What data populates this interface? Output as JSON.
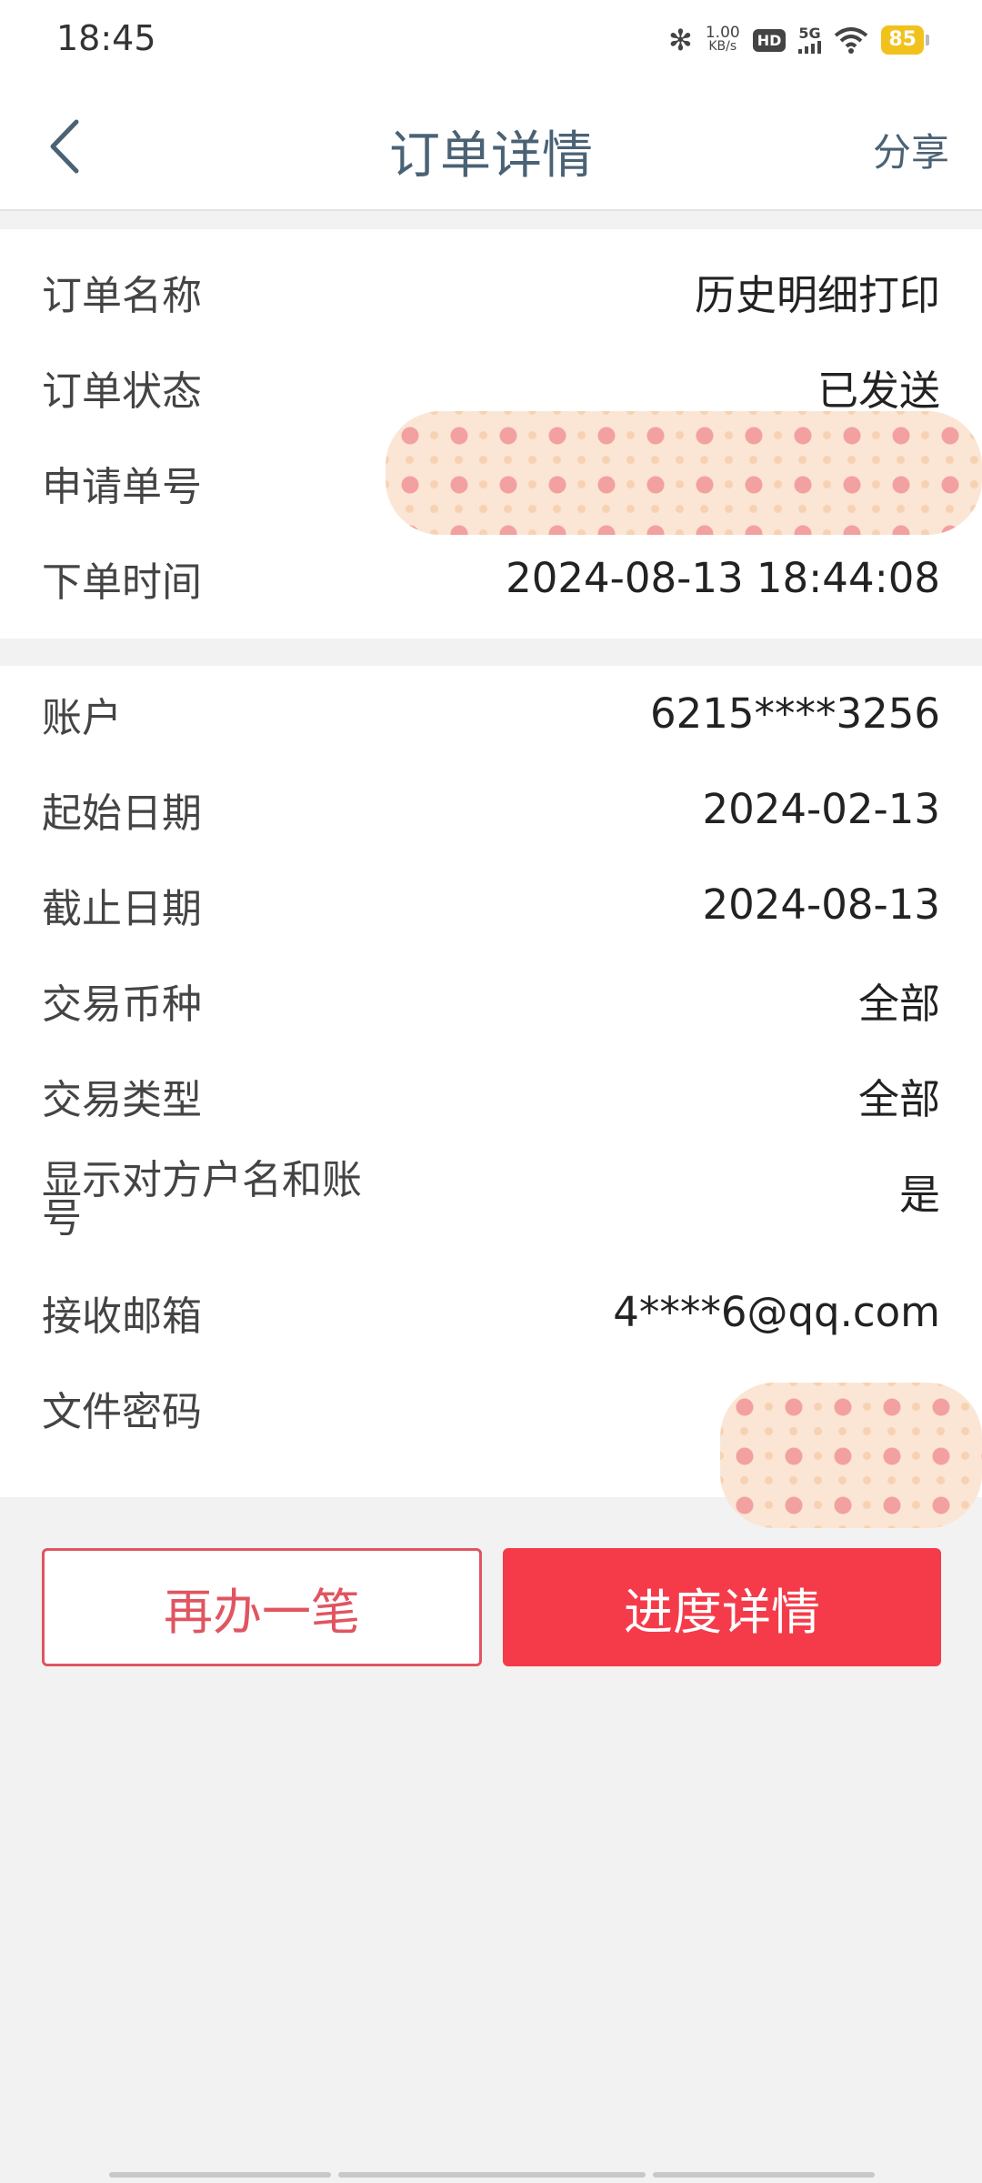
{
  "status_bar": {
    "time": "18:45",
    "speed_value": "1.00",
    "speed_unit": "KB/s",
    "hd": "HD",
    "network": "5G",
    "battery": "85",
    "icons": [
      "bluetooth-icon",
      "hd-icon",
      "signal-icon",
      "wifi-icon",
      "battery-icon"
    ]
  },
  "header": {
    "title": "订单详情",
    "share": "分享"
  },
  "order": {
    "rows": [
      {
        "label": "订单名称",
        "value": "历史明细打印"
      },
      {
        "label": "订单状态",
        "value": "已发送"
      },
      {
        "label": "申请单号",
        "value": ""
      },
      {
        "label": "下单时间",
        "value": "2024-08-13 18:44:08"
      }
    ]
  },
  "details": {
    "rows": [
      {
        "label": "账户",
        "value": "6215****3256"
      },
      {
        "label": "起始日期",
        "value": "2024-02-13"
      },
      {
        "label": "截止日期",
        "value": "2024-08-13"
      },
      {
        "label": "交易币种",
        "value": "全部"
      },
      {
        "label": "交易类型",
        "value": "全部"
      },
      {
        "label": "显示对方户名和账号",
        "value": "是"
      },
      {
        "label": "接收邮箱",
        "value": "4****6@qq.com"
      },
      {
        "label": "文件密码",
        "value": ""
      }
    ]
  },
  "buttons": {
    "again": "再办一笔",
    "progress": "进度详情"
  },
  "colors": {
    "accent": "#f53b4a",
    "title": "#4a6275",
    "background": "#f2f2f2"
  }
}
